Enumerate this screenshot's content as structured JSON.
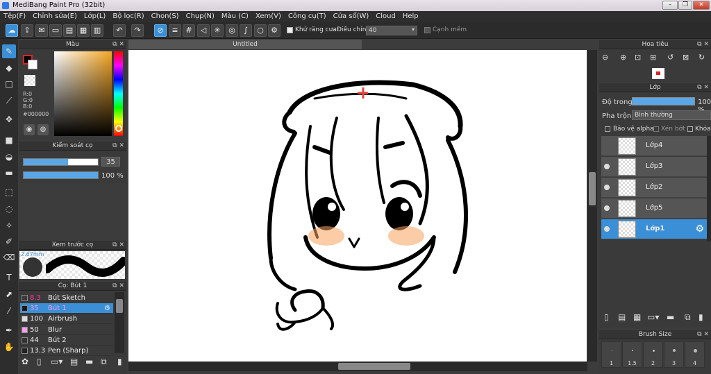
{
  "window": {
    "title": "MediBang Paint Pro (32bit)"
  },
  "menu": [
    "Tệp(F)",
    "Chỉnh sửa(E)",
    "Lớp(L)",
    "Bộ lọc(R)",
    "Chọn(S)",
    "Chụp(N)",
    "Màu (C)",
    "Xem(V)",
    "Công cụ(T)",
    "Cửa sổ(W)",
    "Cloud",
    "Help"
  ],
  "toolbar": {
    "antialias_label": "Khử răng cưa",
    "correction_label": "Điều chỉnh",
    "correction_value": "40",
    "edge_label": "Cạnh mềm"
  },
  "color_panel": {
    "title": "Màu",
    "r": "R:0",
    "g": "G:0",
    "b": "B:0",
    "hex": "#000000"
  },
  "brush_control": {
    "title": "Kiểm soát cọ",
    "size": "35",
    "opacity": "100 %",
    "size_fraction": 0.6,
    "opacity_fraction": 1.0
  },
  "brush_preview": {
    "title": "Xem trước cọ",
    "size_text": "2.67mm"
  },
  "brush_list": {
    "title": "Cọ: Bút 1",
    "items": [
      {
        "size": "8.3",
        "name": "Bút Sketch",
        "swatch": "#3a3a3a",
        "selected": false
      },
      {
        "size": "35",
        "name": "Bút 1",
        "swatch": "#1a1a1a",
        "selected": true
      },
      {
        "size": "100",
        "name": "Airbrush",
        "swatch": "#dddddd",
        "selected": false
      },
      {
        "size": "50",
        "name": "Blur",
        "swatch": "#f7a0ef",
        "selected": false
      },
      {
        "size": "44",
        "name": "Bút 2",
        "swatch": "#333333",
        "selected": false
      },
      {
        "size": "13.3",
        "name": "Pen (Sharp)",
        "swatch": "#222222",
        "selected": false
      }
    ]
  },
  "document": {
    "tab": "Untitled"
  },
  "navigator": {
    "title": "Hoa tiêu"
  },
  "layers": {
    "title": "Lớp",
    "opacity_label": "Độ trong",
    "opacity_value": "100 %",
    "blend_label": "Pha trộn",
    "blend_value": "Bình thường",
    "protect_alpha": "Bảo vệ alpha",
    "clip": "Xén bớt",
    "lock": "Khóa",
    "items": [
      {
        "name": "Lớp4",
        "visible": false,
        "selected": false
      },
      {
        "name": "Lớp3",
        "visible": true,
        "selected": false
      },
      {
        "name": "Lớp2",
        "visible": true,
        "selected": false
      },
      {
        "name": "Lớp5",
        "visible": true,
        "selected": false
      },
      {
        "name": "Lớp1",
        "visible": true,
        "selected": true
      }
    ]
  },
  "brush_size_panel": {
    "title": "Brush Size",
    "sizes": [
      "1",
      "1.5",
      "2",
      "3",
      "4"
    ]
  }
}
